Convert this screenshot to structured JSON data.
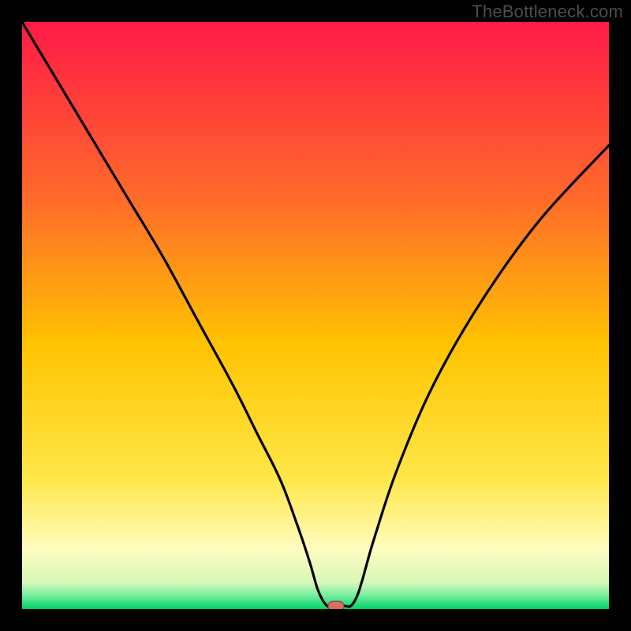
{
  "watermark": "TheBottleneck.com",
  "colors": {
    "background": "#000000",
    "gradient_top": "#ff1a47",
    "gradient_upper": "#ff5a2e",
    "gradient_mid": "#ffb300",
    "gradient_lower_mid": "#ffe23a",
    "gradient_pale": "#ffffbf",
    "gradient_green": "#00e676",
    "curve": "#000000",
    "marker_fill": "#d86a63",
    "marker_stroke": "#7c3b37"
  },
  "chart_data": {
    "type": "line",
    "title": "",
    "xlabel": "",
    "ylabel": "",
    "xlim": [
      0,
      100
    ],
    "ylim": [
      0,
      100
    ],
    "series": [
      {
        "name": "bottleneck-curve",
        "x": [
          0,
          6,
          12,
          18,
          24,
          30,
          36,
          40,
          44,
          47,
          49,
          50.5,
          52,
          53.5,
          55,
          56,
          57,
          58,
          60,
          64,
          70,
          78,
          88,
          100
        ],
        "y": [
          100,
          90,
          80,
          70,
          60,
          49,
          38,
          30,
          22,
          14,
          8,
          3,
          0.5,
          0.5,
          0.5,
          0.5,
          2,
          5,
          12,
          24,
          38,
          52,
          66,
          79
        ]
      }
    ],
    "marker": {
      "x": 53.5,
      "y": 0.5,
      "label": "optimal-point"
    },
    "gradient_stops": [
      {
        "offset": 0.0,
        "color": "#ff1a47"
      },
      {
        "offset": 0.3,
        "color": "#ff6a2a"
      },
      {
        "offset": 0.55,
        "color": "#ffc300"
      },
      {
        "offset": 0.78,
        "color": "#ffe84a"
      },
      {
        "offset": 0.9,
        "color": "#fffcc0"
      },
      {
        "offset": 0.955,
        "color": "#d7f7b8"
      },
      {
        "offset": 0.975,
        "color": "#7ef0a0"
      },
      {
        "offset": 1.0,
        "color": "#00d46a"
      }
    ]
  }
}
